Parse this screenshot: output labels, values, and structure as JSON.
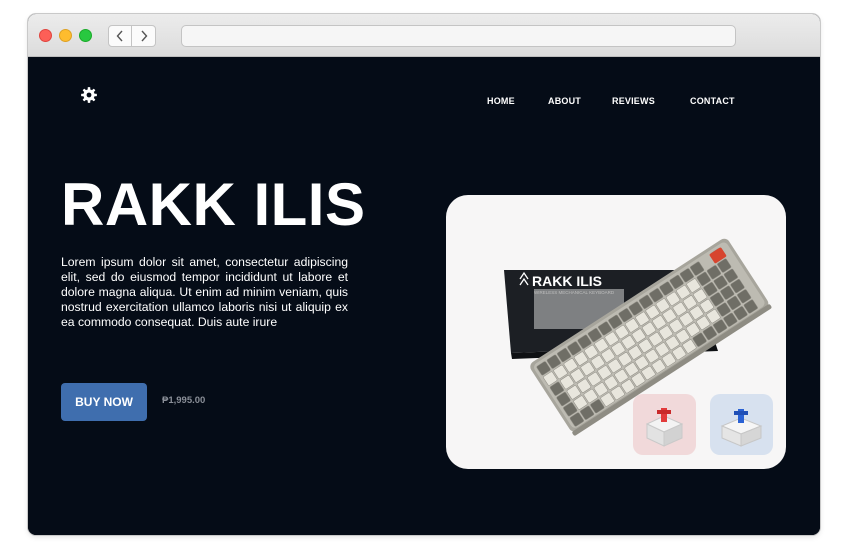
{
  "browser": {
    "back_icon": "chevron-left-icon",
    "forward_icon": "chevron-right-icon",
    "address_value": ""
  },
  "header": {
    "logo_icon": "gear-icon",
    "nav": [
      {
        "label": "HOME"
      },
      {
        "label": "ABOUT"
      },
      {
        "label": "REVIEWS"
      },
      {
        "label": "CONTACT"
      }
    ]
  },
  "hero": {
    "title": "RAKK ILIS",
    "description": "Lorem ipsum dolor sit amet, consectetur adipiscing elit, sed do eiusmod tempor incididunt ut labore et dolore magna aliqua. Ut enim ad minim veniam, quis nostrud exercitation ullamco laboris nisi ut aliquip ex ea commodo consequat. Duis aute irure",
    "buy_label": "BUY NOW",
    "price": "₱1,995.00"
  },
  "product": {
    "box_brand": "RAKK ILIS",
    "switches": [
      {
        "name": "red-switch-icon"
      },
      {
        "name": "blue-switch-icon"
      }
    ]
  },
  "colors": {
    "background": "#050c17",
    "accent": "#3f6eae",
    "card": "#f7f6f6"
  }
}
